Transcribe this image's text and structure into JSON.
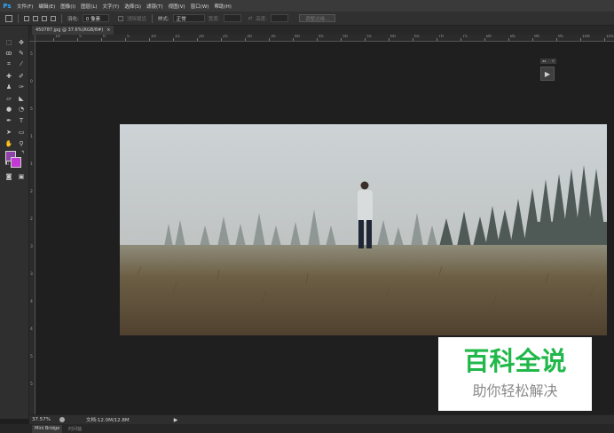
{
  "app": {
    "logo": "Ps"
  },
  "menu": [
    "文件(F)",
    "编辑(E)",
    "图像(I)",
    "图层(L)",
    "文字(Y)",
    "选择(S)",
    "滤镜(T)",
    "视图(V)",
    "窗口(W)",
    "帮助(H)"
  ],
  "options_bar": {
    "feather_label": "羽化:",
    "feather_value": "0 像素",
    "antialias_label": "消除锯齿",
    "style_label": "样式:",
    "style_value": "正常",
    "width_label": "宽度:",
    "height_label": "高度:",
    "refine_button": "调整边缘..."
  },
  "document": {
    "tab_title": "450787.jpg @ 37.6%(RGB/8#)",
    "tab_close": "×"
  },
  "ruler": {
    "top_labels": [
      "10",
      "5",
      "0",
      "5",
      "10",
      "15",
      "20",
      "25",
      "30",
      "35",
      "40",
      "45",
      "50",
      "55",
      "60",
      "65",
      "70",
      "75",
      "80",
      "85",
      "90",
      "95",
      "100",
      "105"
    ],
    "left_labels": [
      "5",
      "0",
      "5",
      "1",
      "1",
      "2",
      "2",
      "3",
      "3",
      "4",
      "4",
      "5",
      "5"
    ]
  },
  "toolbar": {
    "tools": [
      "marquee-tool",
      "move-tool",
      "lasso-tool",
      "quick-select-tool",
      "crop-tool",
      "eyedropper-tool",
      "healing-tool",
      "brush-tool",
      "clone-stamp-tool",
      "history-brush-tool",
      "eraser-tool",
      "paint-bucket-tool",
      "blur-tool",
      "dodge-tool",
      "pen-tool",
      "type-tool",
      "path-select-tool",
      "rectangle-tool",
      "hand-tool",
      "zoom-tool"
    ],
    "foreground_color": "#8f42a7",
    "background_color": "#c23ad3"
  },
  "panel": {
    "collapse": "◂◂",
    "close": "×",
    "play": "▶"
  },
  "watermark": {
    "main": "百科全说",
    "sub": "助你轻松解决"
  },
  "status": {
    "zoom": "37.57%",
    "doc_info": "文档:12.0M/12.8M",
    "arrow": "▶"
  },
  "bottom_tabs": [
    "Mini Bridge",
    "时间轴"
  ]
}
